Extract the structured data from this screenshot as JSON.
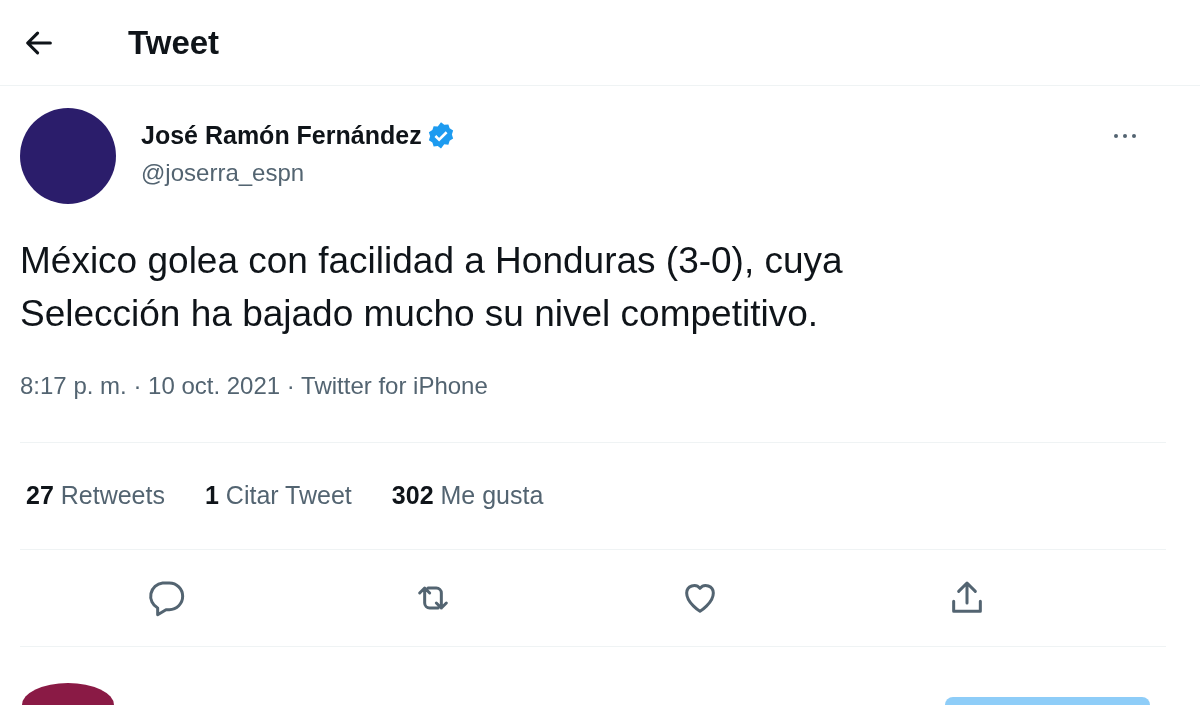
{
  "header": {
    "title": "Tweet"
  },
  "author": {
    "name": "José Ramón Fernández",
    "verified": true,
    "handle": "@joserra_espn"
  },
  "text_lines": [
    "México golea con facilidad a Honduras (3-0), cuya",
    "Selección ha bajado mucho su nivel competitivo."
  ],
  "meta": "8:17 p. m. · 10 oct. 2021 · Twitter for iPhone",
  "stats": [
    {
      "count": "27",
      "label": "Retweets"
    },
    {
      "count": "1",
      "label": "Citar Tweet"
    },
    {
      "count": "302",
      "label": "Me gusta"
    }
  ],
  "actions": [
    {
      "kind": "reply"
    },
    {
      "kind": "retweet"
    },
    {
      "kind": "like"
    },
    {
      "kind": "share"
    }
  ]
}
